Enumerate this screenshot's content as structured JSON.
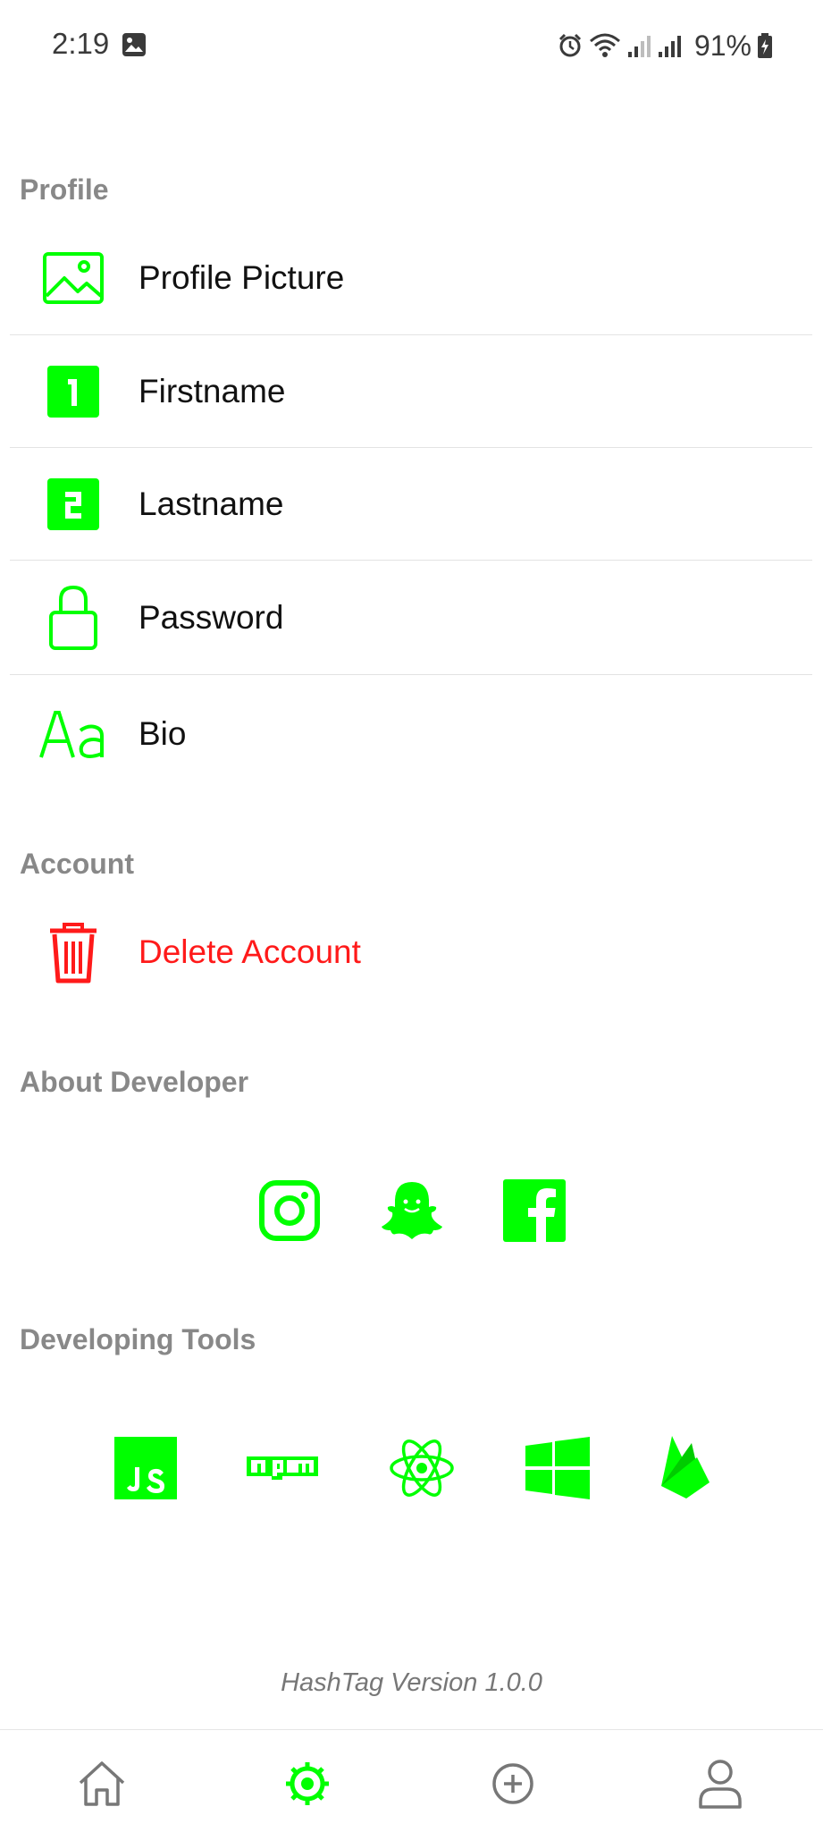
{
  "status_bar": {
    "time": "2:19",
    "battery": "91%"
  },
  "colors": {
    "accent": "#00ff00",
    "danger": "#ff1a1a",
    "section_title": "#888888"
  },
  "sections": {
    "profile": {
      "title": "Profile",
      "items": [
        {
          "label": "Profile Picture",
          "icon": "image-icon"
        },
        {
          "label": "Firstname",
          "icon": "number-one-icon"
        },
        {
          "label": "Lastname",
          "icon": "number-two-icon"
        },
        {
          "label": "Password",
          "icon": "lock-icon"
        },
        {
          "label": "Bio",
          "icon": "text-font-icon"
        }
      ]
    },
    "account": {
      "title": "Account",
      "items": [
        {
          "label": "Delete Account",
          "icon": "trash-icon"
        }
      ]
    },
    "about_developer": {
      "title": "About Developer",
      "icons": [
        "instagram-icon",
        "snapchat-icon",
        "facebook-icon"
      ]
    },
    "developing_tools": {
      "title": "Developing Tools",
      "icons": [
        "javascript-icon",
        "npm-icon",
        "react-icon",
        "windows-icon",
        "firebase-icon"
      ]
    }
  },
  "version_text": "HashTag Version 1.0.0",
  "bottom_nav": {
    "items": [
      {
        "name": "home",
        "icon": "home-icon",
        "active": false
      },
      {
        "name": "settings",
        "icon": "settings-gear-icon",
        "active": true
      },
      {
        "name": "add",
        "icon": "add-circle-icon",
        "active": false
      },
      {
        "name": "profile",
        "icon": "user-icon",
        "active": false
      }
    ]
  }
}
